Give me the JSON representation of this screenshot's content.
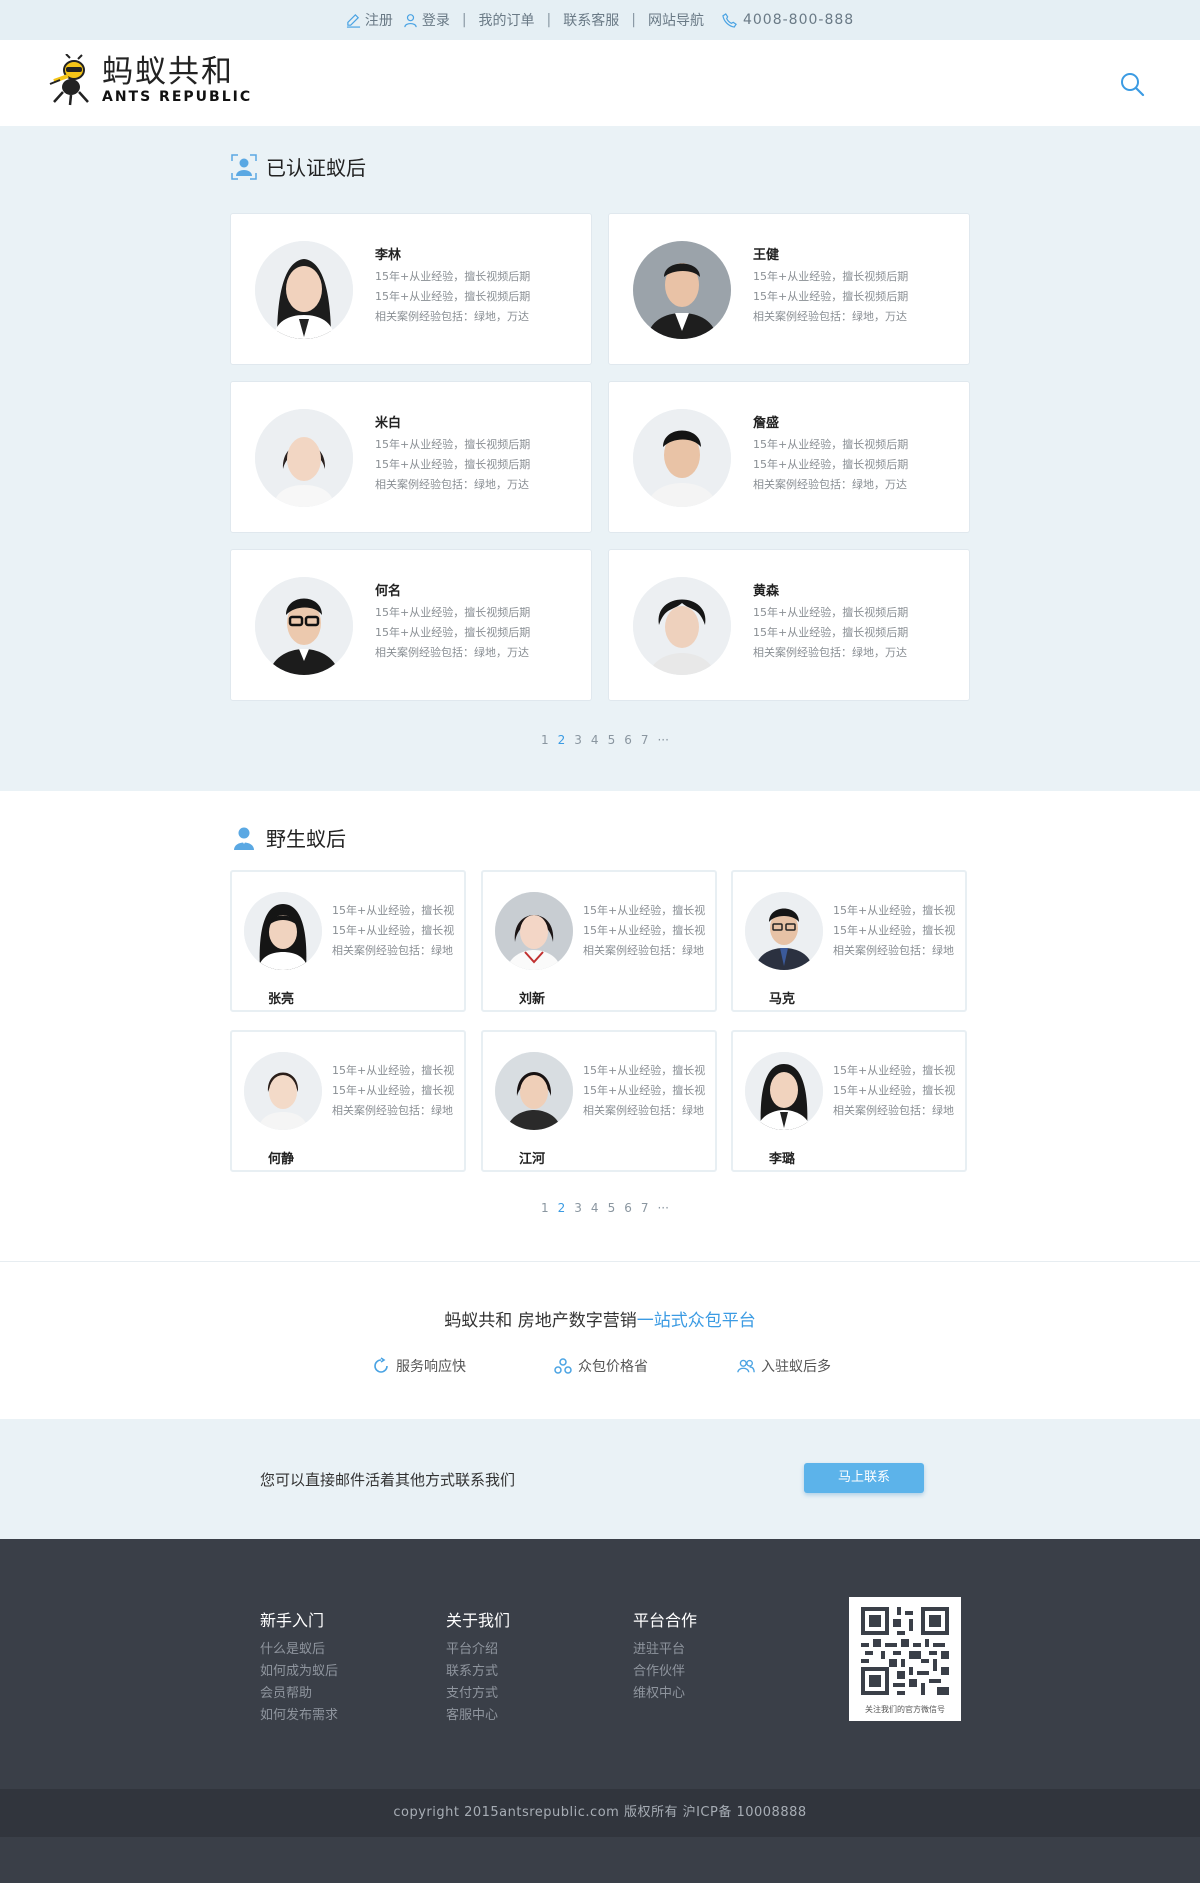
{
  "topbar": {
    "register": "注册",
    "login": "登录",
    "orders": "我的订单",
    "service": "联系客服",
    "nav": "网站导航",
    "phone": "4008-800-888",
    "separator": "|"
  },
  "header": {
    "logo_cn": "蚂蚁共和",
    "logo_en": "ANTS REPUBLIC"
  },
  "certified": {
    "title": "已认证蚁后",
    "cards": [
      {
        "name": "李林",
        "line1": "15年+从业经验，擅长视频后期",
        "line2": "15年+从业经验，擅长视频后期",
        "line3": "相关案例经验包括：绿地，万达"
      },
      {
        "name": "王健",
        "line1": "15年+从业经验，擅长视频后期",
        "line2": "15年+从业经验，擅长视频后期",
        "line3": "相关案例经验包括：绿地，万达"
      },
      {
        "name": "米白",
        "line1": "15年+从业经验，擅长视频后期",
        "line2": "15年+从业经验，擅长视频后期",
        "line3": "相关案例经验包括：绿地，万达"
      },
      {
        "name": "詹盛",
        "line1": "15年+从业经验，擅长视频后期",
        "line2": "15年+从业经验，擅长视频后期",
        "line3": "相关案例经验包括：绿地，万达"
      },
      {
        "name": "何名",
        "line1": "15年+从业经验，擅长视频后期",
        "line2": "15年+从业经验，擅长视频后期",
        "line3": "相关案例经验包括：绿地，万达"
      },
      {
        "name": "黄森",
        "line1": "15年+从业经验，擅长视频后期",
        "line2": "15年+从业经验，擅长视频后期",
        "line3": "相关案例经验包括：绿地，万达"
      }
    ],
    "pager": [
      "1",
      "2",
      "3",
      "4",
      "5",
      "6",
      "7",
      "···"
    ],
    "pager_active": "2"
  },
  "wild": {
    "title": "野生蚁后",
    "cards": [
      {
        "name": "张亮",
        "line1": "15年+从业经验，擅长视",
        "line2": "15年+从业经验，擅长视",
        "line3": "相关案例经验包括：绿地"
      },
      {
        "name": "刘新",
        "line1": "15年+从业经验，擅长视",
        "line2": "15年+从业经验，擅长视",
        "line3": "相关案例经验包括：绿地"
      },
      {
        "name": "马克",
        "line1": "15年+从业经验，擅长视",
        "line2": "15年+从业经验，擅长视",
        "line3": "相关案例经验包括：绿地"
      },
      {
        "name": "何静",
        "line1": "15年+从业经验，擅长视",
        "line2": "15年+从业经验，擅长视",
        "line3": "相关案例经验包括：绿地"
      },
      {
        "name": "江河",
        "line1": "15年+从业经验，擅长视",
        "line2": "15年+从业经验，擅长视",
        "line3": "相关案例经验包括：绿地"
      },
      {
        "name": "李璐",
        "line1": "15年+从业经验，擅长视",
        "line2": "15年+从业经验，擅长视",
        "line3": "相关案例经验包括：绿地"
      }
    ],
    "pager": [
      "1",
      "2",
      "3",
      "4",
      "5",
      "6",
      "7",
      "···"
    ],
    "pager_active": "2"
  },
  "slogan": {
    "text": "蚂蚁共和 房地产数字营销",
    "highlight": "一站式众包平台",
    "features": [
      "服务响应快",
      "众包价格省",
      "入驻蚁后多"
    ]
  },
  "contact": {
    "text": "您可以直接邮件活着其他方式联系我们",
    "button": "马上联系"
  },
  "footer": {
    "columns": [
      {
        "title": "新手入门",
        "links": [
          "什么是蚁后",
          "如何成为蚁后",
          "会员帮助",
          "如何发布需求"
        ]
      },
      {
        "title": "关于我们",
        "links": [
          "平台介绍",
          "联系方式",
          "支付方式",
          "客服中心"
        ]
      },
      {
        "title": "平台合作",
        "links": [
          "进驻平台",
          "合作伙伴",
          "维权中心"
        ]
      }
    ],
    "qr_caption": "关注我们的官方微信号",
    "copyright": "copyright 2015antsrepublic.com 版权所有 沪ICP备 10008888"
  },
  "colors": {
    "accent": "#3b9be3",
    "button": "#5cb3ea",
    "footer_bg": "#3a3f48",
    "light_bg": "#eaf2f6"
  }
}
